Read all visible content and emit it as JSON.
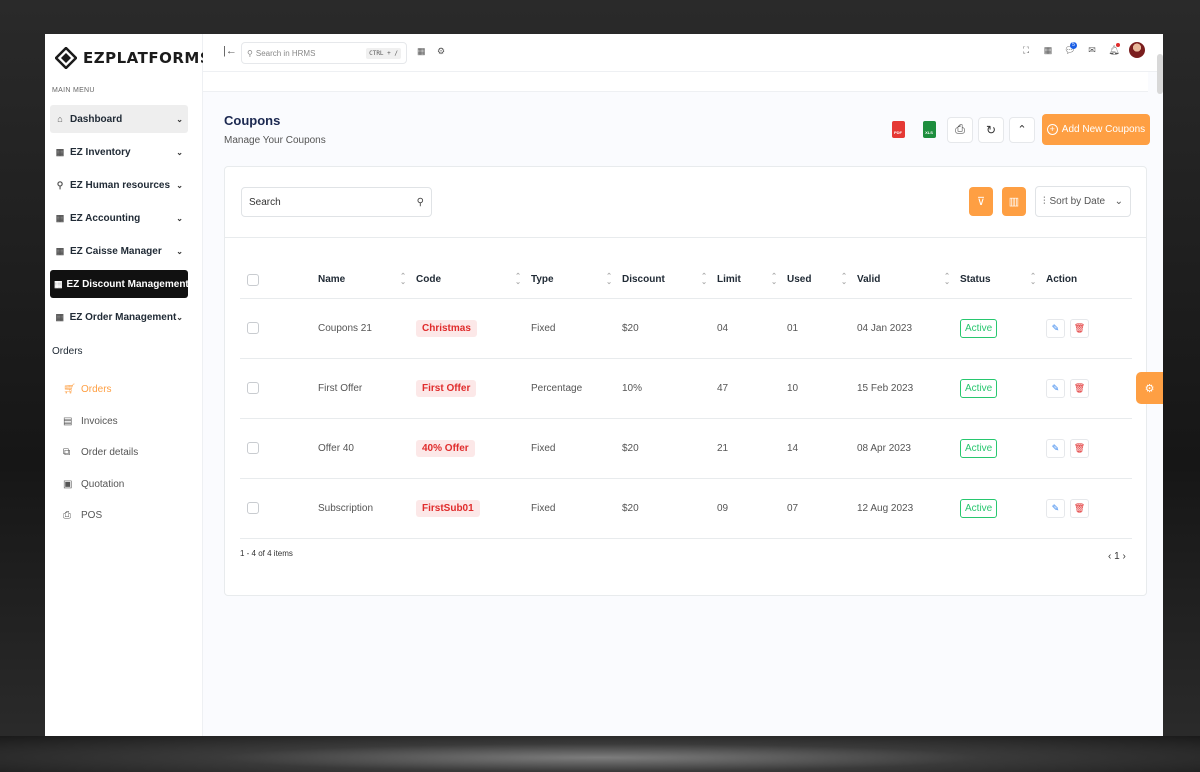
{
  "brand": {
    "name": "EZPLATFORMS"
  },
  "sidebar": {
    "caption": "MAIN MENU",
    "items": [
      {
        "label": "Dashboard",
        "icon": "home-icon"
      },
      {
        "label": "EZ Inventory",
        "icon": "grid-icon"
      },
      {
        "label": "EZ Human resources",
        "icon": "users-icon"
      },
      {
        "label": "EZ Accounting",
        "icon": "grid-icon"
      },
      {
        "label": "EZ Caisse Manager",
        "icon": "grid-icon"
      },
      {
        "label": "EZ Discount Management",
        "icon": "grid-icon"
      },
      {
        "label": "EZ Order Management",
        "icon": "grid-icon"
      }
    ],
    "section_title": "Orders",
    "sub_items": [
      {
        "label": "Orders",
        "icon": "cart-icon"
      },
      {
        "label": "Invoices",
        "icon": "file-icon"
      },
      {
        "label": "Order details",
        "icon": "copy-icon"
      },
      {
        "label": "Quotation",
        "icon": "save-icon"
      },
      {
        "label": "POS",
        "icon": "printer-icon"
      }
    ]
  },
  "topbar": {
    "search_placeholder": "Search in HRMS",
    "shortcut": "CTRL + /",
    "notification_count": "5"
  },
  "page": {
    "title": "Coupons",
    "subtitle": "Manage Your Coupons",
    "pdf_label": "PDF",
    "xls_label": "XLS",
    "add_button": "Add New Coupons"
  },
  "table": {
    "search_label": "Search",
    "sort_label": "Sort by Date",
    "columns": [
      "Name",
      "Code",
      "Type",
      "Discount",
      "Limit",
      "Used",
      "Valid",
      "Status",
      "Action"
    ],
    "rows": [
      {
        "name": "Coupons 21",
        "code": "Christmas",
        "type": "Fixed",
        "discount": "$20",
        "limit": "04",
        "used": "01",
        "valid": "04 Jan 2023",
        "status": "Active"
      },
      {
        "name": "First Offer",
        "code": "First Offer",
        "type": "Percentage",
        "discount": "10%",
        "limit": "47",
        "used": "10",
        "valid": "15 Feb 2023",
        "status": "Active"
      },
      {
        "name": "Offer 40",
        "code": "40% Offer",
        "type": "Fixed",
        "discount": "$20",
        "limit": "21",
        "used": "14",
        "valid": "08 Apr 2023",
        "status": "Active"
      },
      {
        "name": "Subscription",
        "code": "FirstSub01",
        "type": "Fixed",
        "discount": "$20",
        "limit": "09",
        "used": "07",
        "valid": "12 Aug 2023",
        "status": "Active"
      }
    ],
    "pager_info": "1 - 4 of 4 items",
    "current_page": "1"
  },
  "colors": {
    "accent": "#fe9f43",
    "danger": "#e02c2c",
    "success": "#28c76f",
    "dark": "#111111"
  }
}
